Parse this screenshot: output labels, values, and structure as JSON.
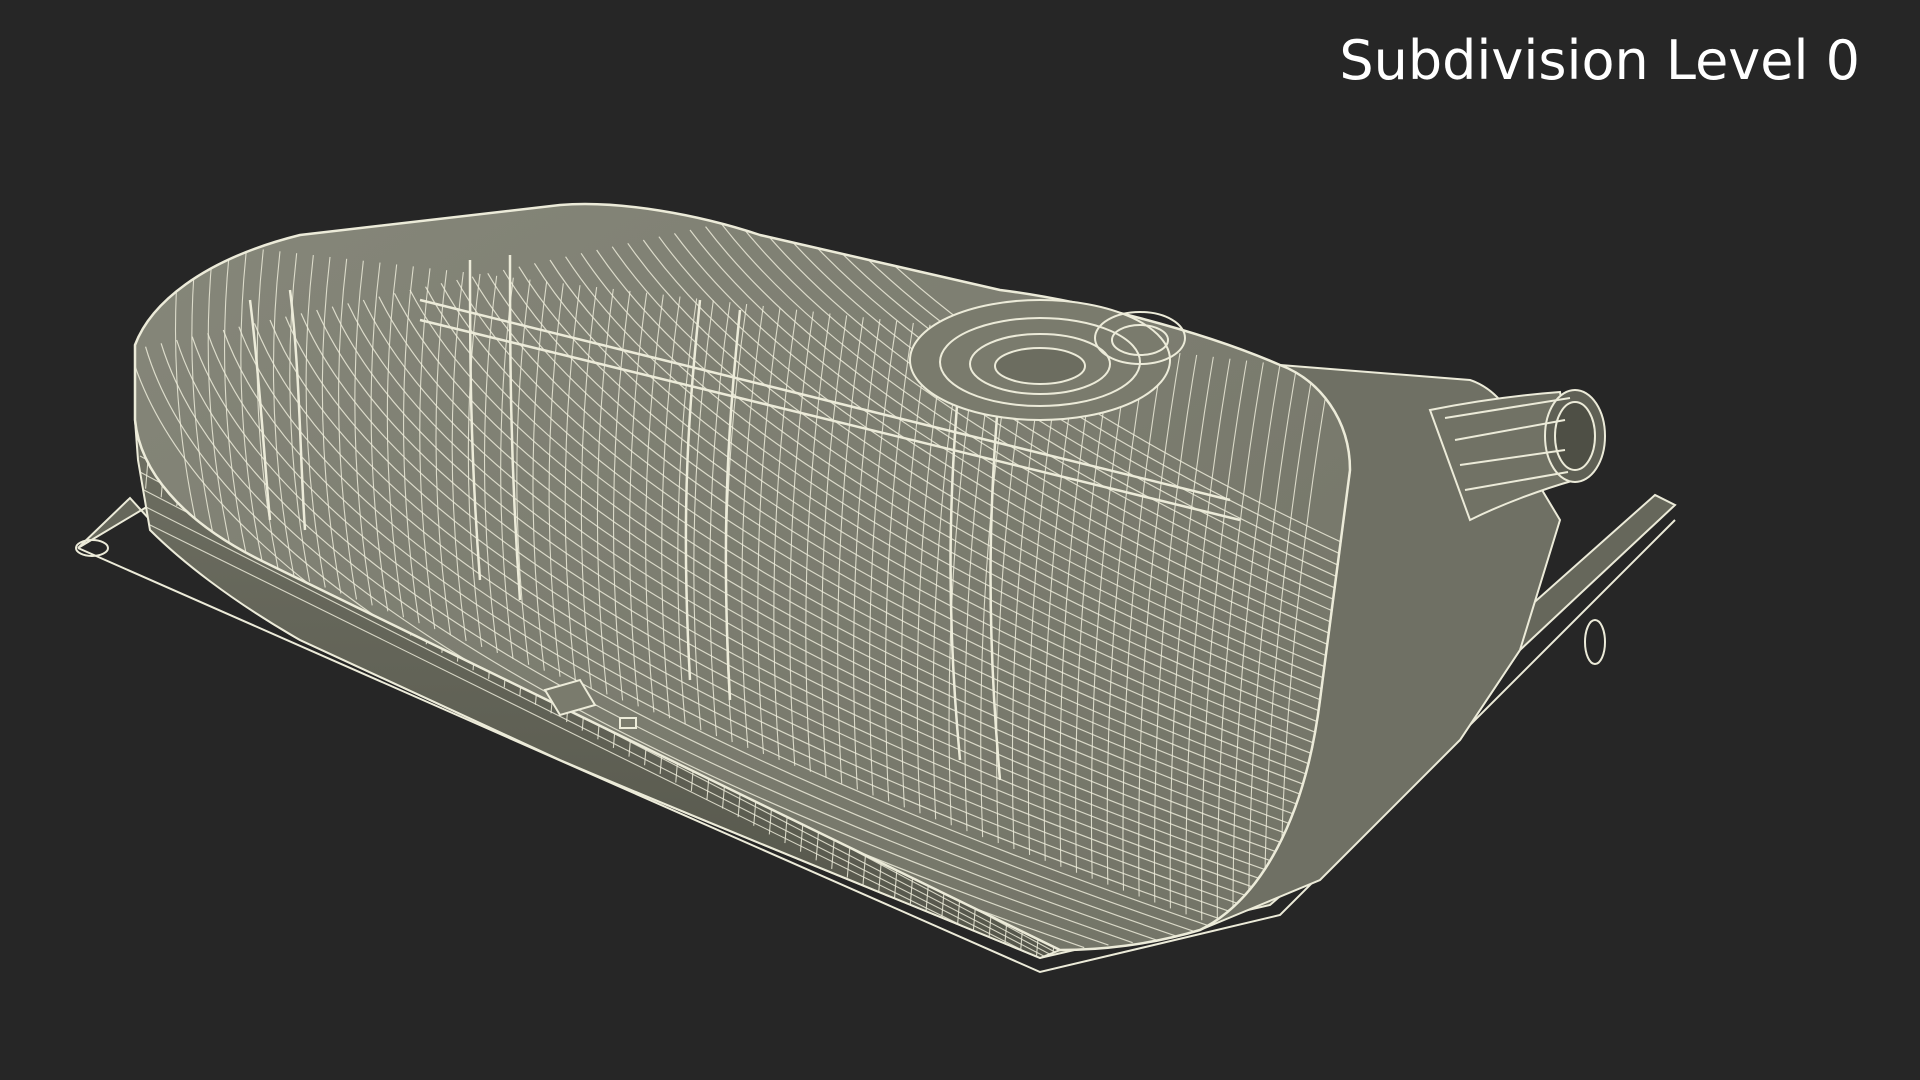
{
  "overlay": {
    "subdivision_label": "Subdivision Level 0"
  },
  "scene": {
    "subject_icon": "fuel-tank-wireframe-icon",
    "background_color": "#262626",
    "mesh_fill_color": "#7d7e6e",
    "mesh_shadow_color": "#5e5f52",
    "wire_color": "#ecebd9",
    "label_color": "#ffffff"
  }
}
